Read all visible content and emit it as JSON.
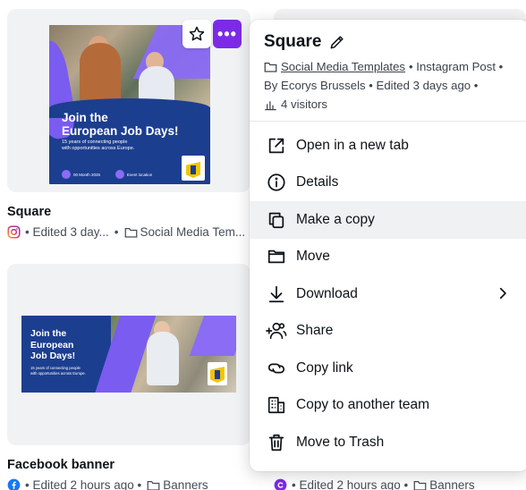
{
  "cards": [
    {
      "title": "Square",
      "meta_edited": "• Edited 3 day...",
      "meta_folder": "Social Media Tem...",
      "platform_icon": "instagram-icon",
      "design": {
        "title_line1": "Join the",
        "title_line2": "European Job Days!",
        "subtitle_line1": "15 years of connecting people",
        "subtitle_line2": "with opportunities across Europe.",
        "date": "00 Month 2026",
        "location": "Event location"
      }
    },
    {
      "title": "Facebook banner",
      "meta_edited": "• Edited 2 hours ago •",
      "meta_folder": "Banners",
      "platform_icon": "facebook-icon",
      "design": {
        "title_line1": "Join the",
        "title_line2": "European",
        "title_line3": "Job Days!",
        "subtitle_line1": "15 years of connecting people",
        "subtitle_line2": "with opportunities across Europe."
      }
    },
    {
      "title": "",
      "meta_edited": "• Edited 2 hours ago •",
      "meta_folder": "Banners",
      "platform_icon": "canva-icon"
    }
  ],
  "hover_actions": {
    "star_icon": "star-icon",
    "more_label": "•••"
  },
  "menu": {
    "title": "Square",
    "folder_link": "Social Media Templates",
    "meta_line1_suffix": "• Instagram Post •",
    "meta_line2": "By Ecorys Brussels • Edited 3 days ago •",
    "visitors": "4 visitors",
    "items": [
      {
        "label": "Open in a new tab",
        "icon": "open-external-icon"
      },
      {
        "label": "Details",
        "icon": "info-icon"
      },
      {
        "label": "Make a copy",
        "icon": "copy-icon",
        "active": true
      },
      {
        "label": "Move",
        "icon": "folder-icon"
      },
      {
        "label": "Download",
        "icon": "download-icon",
        "submenu": true
      },
      {
        "label": "Share",
        "icon": "share-people-icon"
      },
      {
        "label": "Copy link",
        "icon": "link-icon"
      },
      {
        "label": "Copy to another team",
        "icon": "team-building-icon"
      },
      {
        "label": "Move to Trash",
        "icon": "trash-icon"
      }
    ]
  },
  "colors": {
    "accent": "#7d2ae8",
    "design_blue": "#1c3e8f",
    "design_purple": "#7a5cf0",
    "menu_active_bg": "#f0f1f3"
  }
}
